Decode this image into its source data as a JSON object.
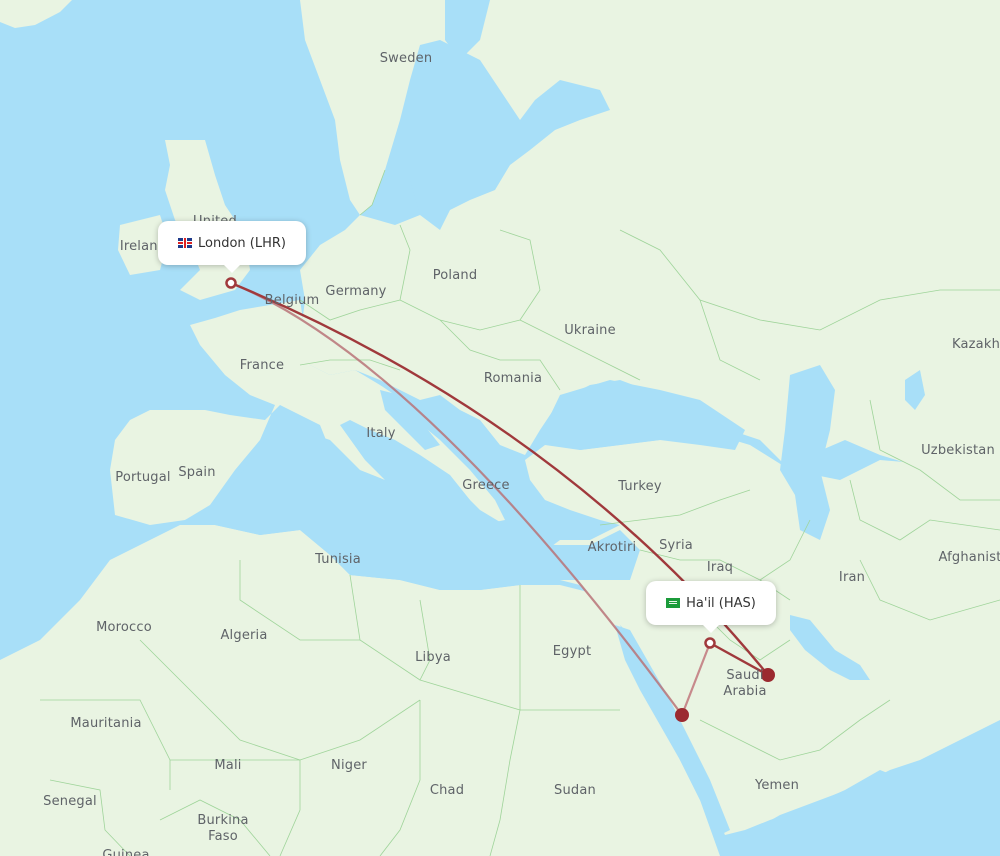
{
  "map": {
    "colors": {
      "water": "#a8dff8",
      "land": "#e9f4e2",
      "border": "#9fd49a",
      "route": "#a0393c",
      "route_light": "#c78a8c",
      "marker": "#9b2a30"
    },
    "origin": {
      "label": "London (LHR)",
      "flag_icon": "uk-flag-icon"
    },
    "destination": {
      "label": "Ha'il (HAS)",
      "flag_icon": "saudi-flag-icon"
    },
    "countries": [
      {
        "name": "Sweden"
      },
      {
        "name": "United"
      },
      {
        "name": "Ireland"
      },
      {
        "name": "Poland"
      },
      {
        "name": "Belgium"
      },
      {
        "name": "Germany"
      },
      {
        "name": "Ukraine"
      },
      {
        "name": "France"
      },
      {
        "name": "Romania"
      },
      {
        "name": "Kazakh"
      },
      {
        "name": "Italy"
      },
      {
        "name": "Uzbekistan"
      },
      {
        "name": "Portugal"
      },
      {
        "name": "Spain"
      },
      {
        "name": "Greece"
      },
      {
        "name": "Turkey"
      },
      {
        "name": "Tunisia"
      },
      {
        "name": "Akrotiri"
      },
      {
        "name": "Syria"
      },
      {
        "name": "Afghanist"
      },
      {
        "name": "Iraq"
      },
      {
        "name": "Iran"
      },
      {
        "name": "Morocco"
      },
      {
        "name": "Algeria"
      },
      {
        "name": "Libya"
      },
      {
        "name": "Egypt"
      },
      {
        "name": "Saudi\nArabia"
      },
      {
        "name": "Mauritania"
      },
      {
        "name": "Mali"
      },
      {
        "name": "Niger"
      },
      {
        "name": "Chad"
      },
      {
        "name": "Sudan"
      },
      {
        "name": "Yemen"
      },
      {
        "name": "Senegal"
      },
      {
        "name": "Burkina\nFaso"
      },
      {
        "name": "Guinea"
      }
    ]
  }
}
